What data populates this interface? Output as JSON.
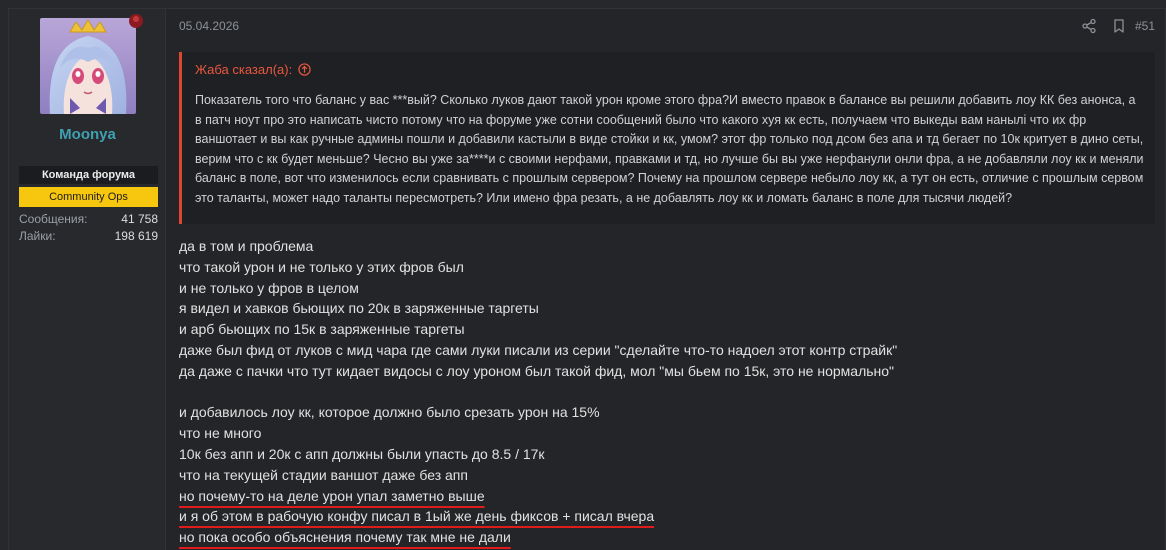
{
  "user": {
    "username": "Moonya",
    "role_team": "Команда форума",
    "role_ops": "Community Ops",
    "stats": [
      {
        "label": "Сообщения:",
        "value": "41 758"
      },
      {
        "label": "Лайки:",
        "value": "198 619"
      }
    ],
    "username_color": "#3fa0b0",
    "ops_badge_color": "#f6c70e"
  },
  "post": {
    "date": "05.04.2026",
    "number": "#51",
    "actions": [
      "share-icon",
      "bookmark-icon"
    ]
  },
  "quote": {
    "author": "Жаба сказал(а):",
    "text": "Показатель того что баланс у вас ***вый? Сколько луков дают такой урон кроме этого фра?И вместо правок в балансе вы решили добавить лоу КК без анонса, а в патч ноут про это написать чисто потому что на форуме уже сотни сообщений было что какого хуя кк есть, получаем что выкеды вам нанылi что их фр ваншотает и вы как ручные админы пошли и добавили кастыли в виде стойки и кк, умом? этот фр только под дсом без апа и тд бегает по 10к критует в дино сеты, верим что с кк будет меньше? Чесно вы уже за****и с своими нерфами, правками и тд, но лучше бы вы уже нерфанули онли фра, а не добавляли лоу кк и меняли баланс в поле, вот что изменилось если сравнивать с прошлым сервером? Почему на прошлом сервере небыло лоу кк, а тут он есть, отличие с прошлым сервом это таланты, может надо таланты пересмотреть? Или имено фра резать, а не добавлять лоу кк и ломать баланс в поле для тысячи людей?",
    "accent_color": "#e0462e"
  },
  "message": {
    "lines": [
      "да в том и проблема",
      "что такой урон и не только у этих фров был",
      "и не только у фров в целом",
      "я видел и хавков бьющих по 20к в заряженные таргеты",
      "и арб бьющих по 15к в заряженные таргеты",
      "даже был фид от луков с мид чара где сами луки писали из серии \"сделайте что-то надоел этот контр страйк\"",
      "да даже с пачки что тут кидает видосы с лоу уроном был такой фид, мол \"мы бьем по 15к, это не нормально\"",
      "",
      "и добавилось лоу кк, которое должно было срезать урон на 15%",
      "что не много",
      "10к без апп и 20к с апп должны были упасть до 8.5 / 17к",
      "что на текущей стадии ваншот даже без апп",
      "но почему-то на деле урон упал заметно выше",
      "и я об этом в рабочую конфу писал в 1ый же день фиксов + писал вчера",
      "но пока особо объяснения почему так мне не дали"
    ],
    "underline_color": "#e01b1b"
  }
}
